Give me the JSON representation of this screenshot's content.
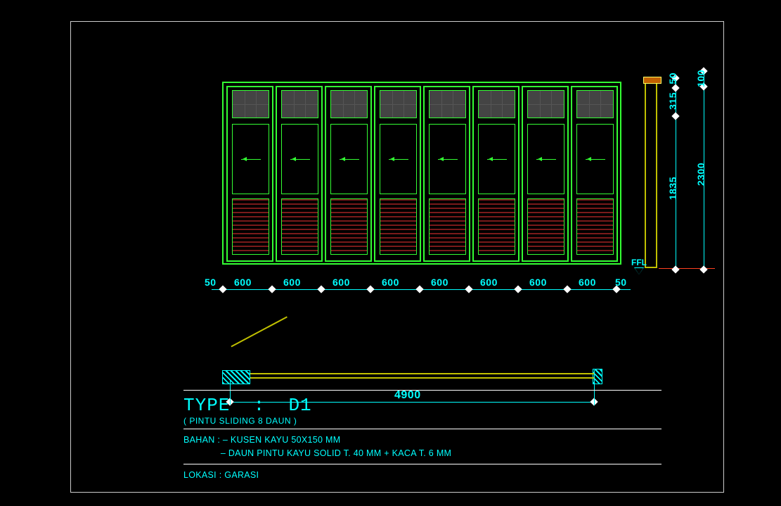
{
  "drawing": {
    "type_label": "TYPE",
    "type_value": "D1",
    "subtitle": "( PINTU SLIDING 8 DAUN )",
    "bahan_label": "BAHAN :",
    "bahan_1": "– KUSEN KAYU 50X150 MM",
    "bahan_2": "– DAUN PINTU KAYU SOLID T. 40 MM + KACA T. 6 MM",
    "lokasi_label": "LOKASI :",
    "lokasi_value": "GARASI",
    "ffl": "FFL"
  },
  "dims": {
    "panel_w": "600",
    "edge_w": "50",
    "total_w_plan": "4900",
    "h_total": "2300",
    "h_mid": "1835",
    "h_win": "315",
    "h_top1": "50",
    "h_top2": "100"
  },
  "chart_data": {
    "type": "diagram",
    "title": "TYPE : D1 (PINTU SLIDING 8 DAUN)",
    "elevation": {
      "panels": 8,
      "panel_width_mm": 600,
      "frame_edge_mm": 50,
      "total_width_mm": 4900,
      "total_height_mm": 2300,
      "segments_vertical_mm": [
        50,
        100,
        315,
        1835
      ],
      "panel_composition": [
        "glass_grid_top",
        "solid_mid_with_arrow",
        "louver_bottom"
      ]
    },
    "plan": {
      "opening_width_mm": 4900
    },
    "materials": {
      "kusen": "KAYU 50X150 MM",
      "daun": "KAYU SOLID T.40 MM + KACA T.6 MM"
    },
    "location": "GARASI",
    "reference_level": "FFL"
  }
}
